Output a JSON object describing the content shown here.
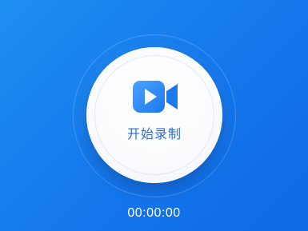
{
  "record": {
    "label": "开始录制",
    "icon": "video-camera-icon"
  },
  "timer": {
    "elapsed": "00:00:00"
  },
  "colors": {
    "background": "#1477ec",
    "button": "#ffffff",
    "accent": "#2f87f0",
    "label": "#2a6ed8"
  }
}
